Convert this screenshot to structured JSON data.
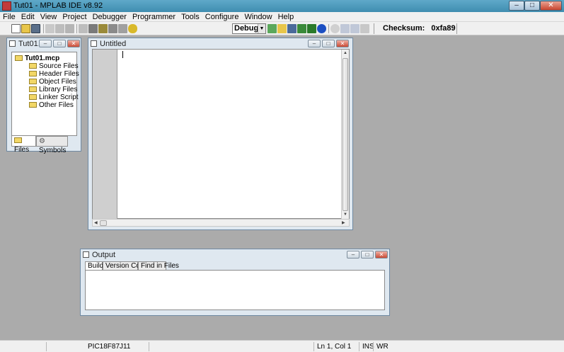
{
  "window": {
    "title": "Tut01 - MPLAB IDE v8.92",
    "minimize": "–",
    "maximize": "□",
    "close": "✕"
  },
  "menu": [
    "File",
    "Edit",
    "View",
    "Project",
    "Debugger",
    "Programmer",
    "Tools",
    "Configure",
    "Window",
    "Help"
  ],
  "toolbar": {
    "config": "Debug",
    "checksum_label": "Checksum:",
    "checksum_value": "0xfa89"
  },
  "project_window": {
    "title": "Tut01...",
    "root": "Tut01.mcp",
    "folders": [
      "Source Files",
      "Header Files",
      "Object Files",
      "Library Files",
      "Linker Script",
      "Other Files"
    ],
    "tabs": [
      "Files",
      "Symbols"
    ]
  },
  "editor_window": {
    "title": "Untitled"
  },
  "output_window": {
    "title": "Output",
    "tabs": [
      "Build",
      "Version Control",
      "Find in Files"
    ]
  },
  "status": {
    "device": "PIC18F87J11",
    "position": "Ln 1, Col 1",
    "ins": "INS",
    "wr": "WR"
  },
  "colors": {
    "titlebar": "#4a9abd",
    "workspace": "#ababab",
    "gutter": "#cfcfcf",
    "close": "#c8452f"
  },
  "icons": [
    "new-file-icon",
    "open-folder-icon",
    "save-icon",
    "cut-icon",
    "copy-icon",
    "paste-icon",
    "print-icon",
    "find-icon",
    "find-in-files-icon",
    "bookmark-icon",
    "help-icon",
    "build-icon",
    "make-icon",
    "build-all-icon",
    "info-icon"
  ]
}
